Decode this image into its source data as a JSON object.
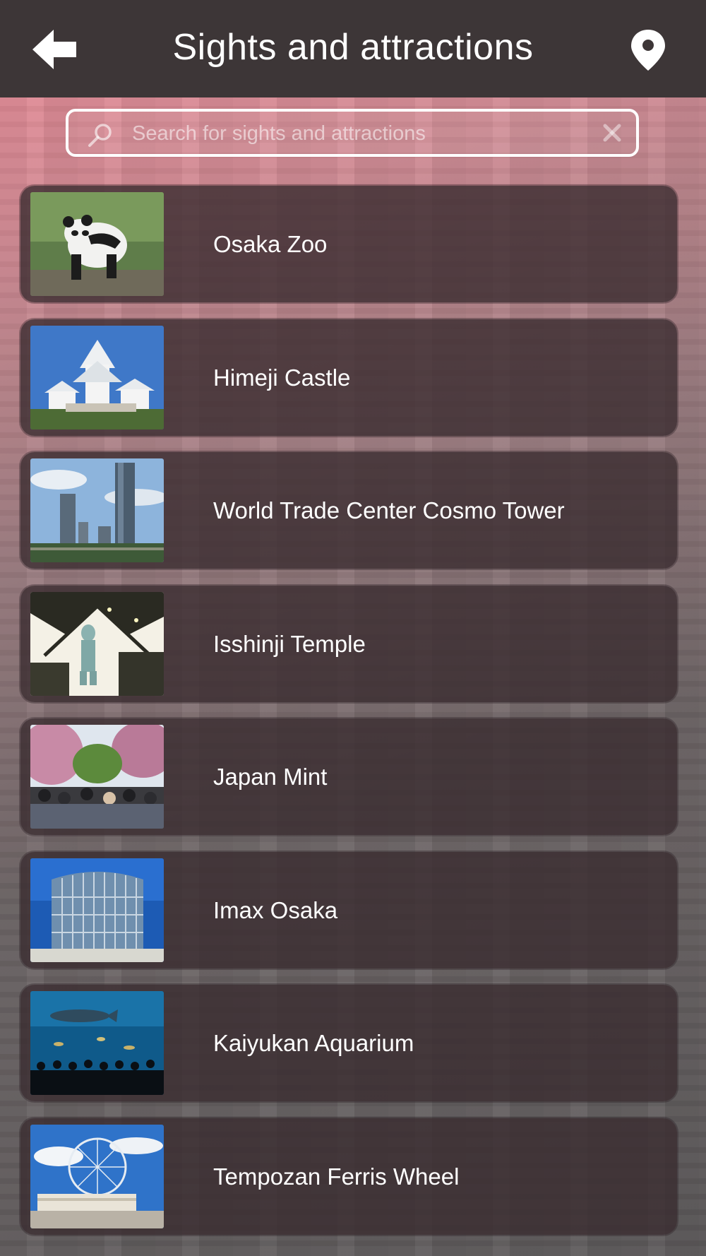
{
  "header": {
    "title": "Sights and attractions",
    "back_icon": "arrow-left-icon",
    "map_icon": "map-pin-icon"
  },
  "search": {
    "placeholder": "Search for sights and attractions",
    "value": "",
    "search_icon": "magnifier-icon",
    "clear_icon": "close-icon"
  },
  "colors": {
    "header_bg": "#3d3637",
    "card_bg": "#3a2c30",
    "text": "#ffffff",
    "gradient_top": "#e88a95",
    "gradient_bottom": "#5d5a5b"
  },
  "items": [
    {
      "label": "Osaka Zoo",
      "thumbnail": "panda-photo"
    },
    {
      "label": "Himeji Castle",
      "thumbnail": "castle-photo"
    },
    {
      "label": "World Trade Center Cosmo Tower",
      "thumbnail": "skyscraper-photo"
    },
    {
      "label": "Isshinji Temple",
      "thumbnail": "statue-photo"
    },
    {
      "label": "Japan Mint",
      "thumbnail": "cherry-blossom-crowd-photo"
    },
    {
      "label": "Imax Osaka",
      "thumbnail": "glass-building-photo"
    },
    {
      "label": "Kaiyukan Aquarium",
      "thumbnail": "aquarium-photo"
    },
    {
      "label": "Tempozan Ferris Wheel",
      "thumbnail": "ferris-wheel-photo"
    }
  ]
}
